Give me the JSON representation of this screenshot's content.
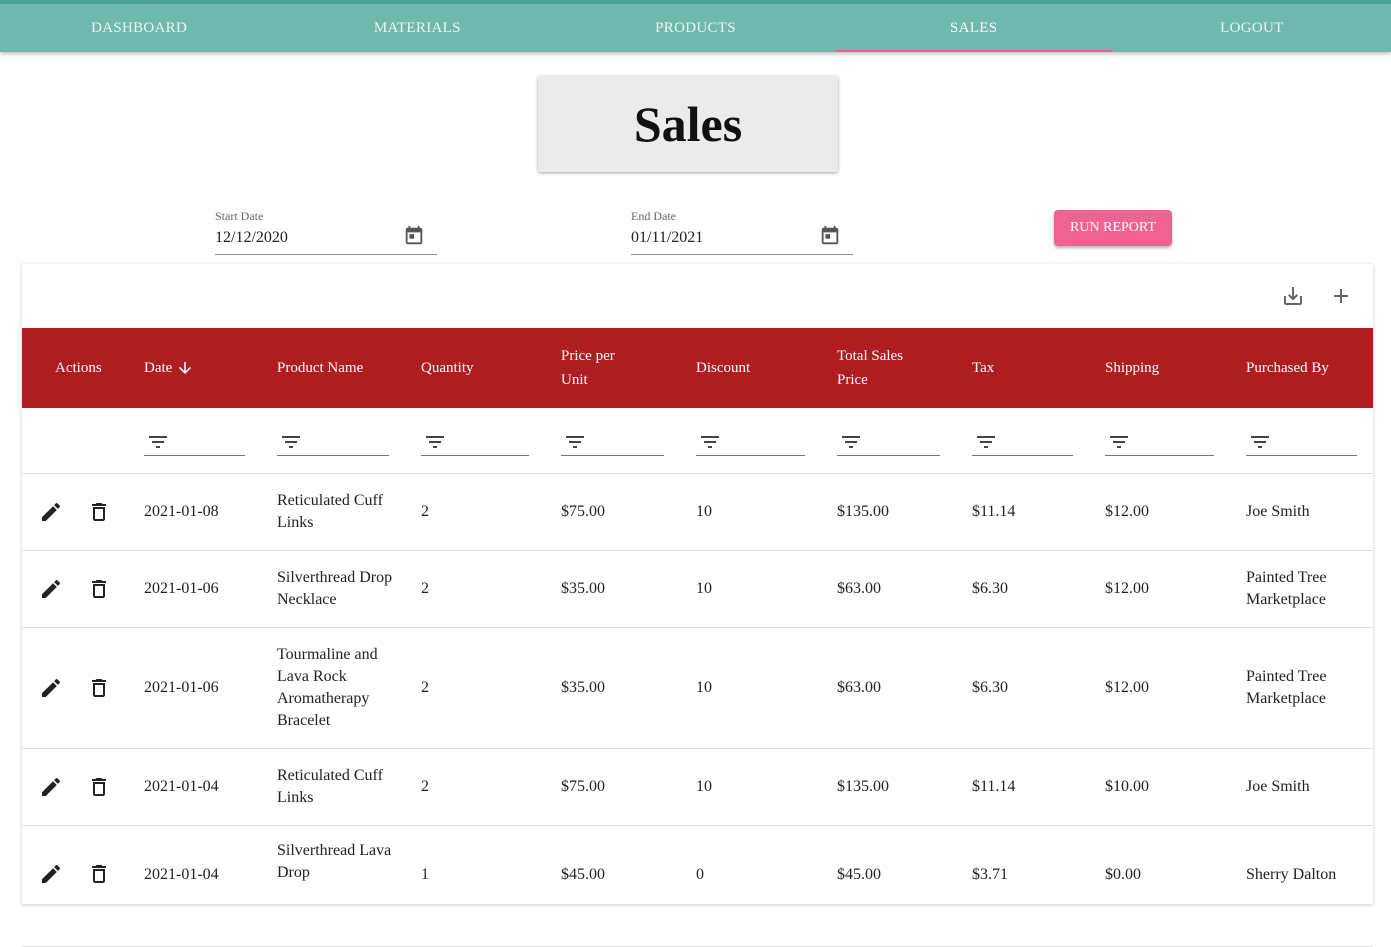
{
  "nav": {
    "tabs": [
      {
        "label": "DASHBOARD"
      },
      {
        "label": "MATERIALS"
      },
      {
        "label": "PRODUCTS"
      },
      {
        "label": "SALES"
      },
      {
        "label": "LOGOUT"
      }
    ],
    "active": "SALES",
    "accent_color": "#f06292",
    "bar_color": "#6fb8ad"
  },
  "page": {
    "title": "Sales"
  },
  "filters": {
    "start_date": {
      "label": "Start Date",
      "value": "12/12/2020"
    },
    "end_date": {
      "label": "End Date",
      "value": "01/11/2021"
    },
    "run_report_label": "RUN REPORT"
  },
  "toolbar": {
    "export_icon": "download-icon",
    "add_icon": "plus-icon"
  },
  "table": {
    "header_color": "#ae1d20",
    "columns": [
      {
        "label": "Actions"
      },
      {
        "label": "Date"
      },
      {
        "label": "Product Name"
      },
      {
        "label": "Quantity"
      },
      {
        "label": "Price per Unit"
      },
      {
        "label": "Discount"
      },
      {
        "label": "Total Sales Price"
      },
      {
        "label": "Tax"
      },
      {
        "label": "Shipping"
      },
      {
        "label": "Purchased By"
      }
    ],
    "sort_column": "Date",
    "sort_direction": "descending",
    "rows": [
      {
        "date": "2021-01-08",
        "product": "Reticulated Cuff Links",
        "quantity": "2",
        "price": "$75.00",
        "discount": "10",
        "total": "$135.00",
        "tax": "$11.14",
        "shipping": "$12.00",
        "purchased_by": "Joe Smith"
      },
      {
        "date": "2021-01-06",
        "product": "Silverthread Drop Necklace",
        "quantity": "2",
        "price": "$35.00",
        "discount": "10",
        "total": "$63.00",
        "tax": "$6.30",
        "shipping": "$12.00",
        "purchased_by": "Painted Tree Marketplace"
      },
      {
        "date": "2021-01-06",
        "product": "Tourmaline and Lava Rock Aromatherapy Bracelet",
        "quantity": "2",
        "price": "$35.00",
        "discount": "10",
        "total": "$63.00",
        "tax": "$6.30",
        "shipping": "$12.00",
        "purchased_by": "Painted Tree Marketplace"
      },
      {
        "date": "2021-01-04",
        "product": "Reticulated Cuff Links",
        "quantity": "2",
        "price": "$75.00",
        "discount": "10",
        "total": "$135.00",
        "tax": "$11.14",
        "shipping": "$10.00",
        "purchased_by": "Joe Smith"
      },
      {
        "date": "2021-01-04",
        "product": "Silverthread Lava Drop",
        "quantity": "1",
        "price": "$45.00",
        "discount": "0",
        "total": "$45.00",
        "tax": "$3.71",
        "shipping": "$0.00",
        "purchased_by": "Sherry Dalton"
      }
    ]
  }
}
